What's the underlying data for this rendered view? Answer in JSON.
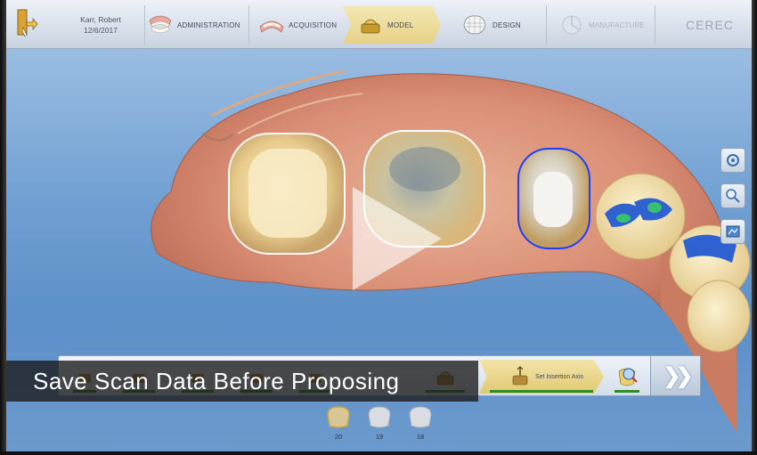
{
  "header": {
    "patient_name": "Karr, Robert",
    "patient_date": "12/6/2017",
    "steps": [
      {
        "label": "ADMINISTRATION",
        "state": "done"
      },
      {
        "label": "ACQUISITION",
        "state": "done"
      },
      {
        "label": "MODEL",
        "state": "active"
      },
      {
        "label": "DESIGN",
        "state": "pending"
      },
      {
        "label": "MANUFACTURE",
        "state": "disabled"
      }
    ],
    "brand": "CEREC"
  },
  "subbar": {
    "steps": [
      {
        "label": ""
      },
      {
        "label": ""
      },
      {
        "label": ""
      },
      {
        "label": ""
      },
      {
        "label": ""
      },
      {
        "label": ""
      },
      {
        "label": "Set Insertion Axis"
      },
      {
        "label": ""
      }
    ],
    "next_icon": "double-chevron-right-icon"
  },
  "caption": {
    "text": "Save Scan Data Before Proposing"
  },
  "teeth": [
    {
      "number": "20",
      "selected": true
    },
    {
      "number": "19",
      "selected": false
    },
    {
      "number": "18",
      "selected": false
    }
  ],
  "tools": [
    "rotate-view-icon",
    "zoom-view-icon",
    "model-view-icon"
  ],
  "colors": {
    "accent_gold": "#e6d185",
    "underline_green": "#2c8c2c",
    "prep_margin_blue": "#1f3cff",
    "background_blue": "#6f9fd2"
  }
}
